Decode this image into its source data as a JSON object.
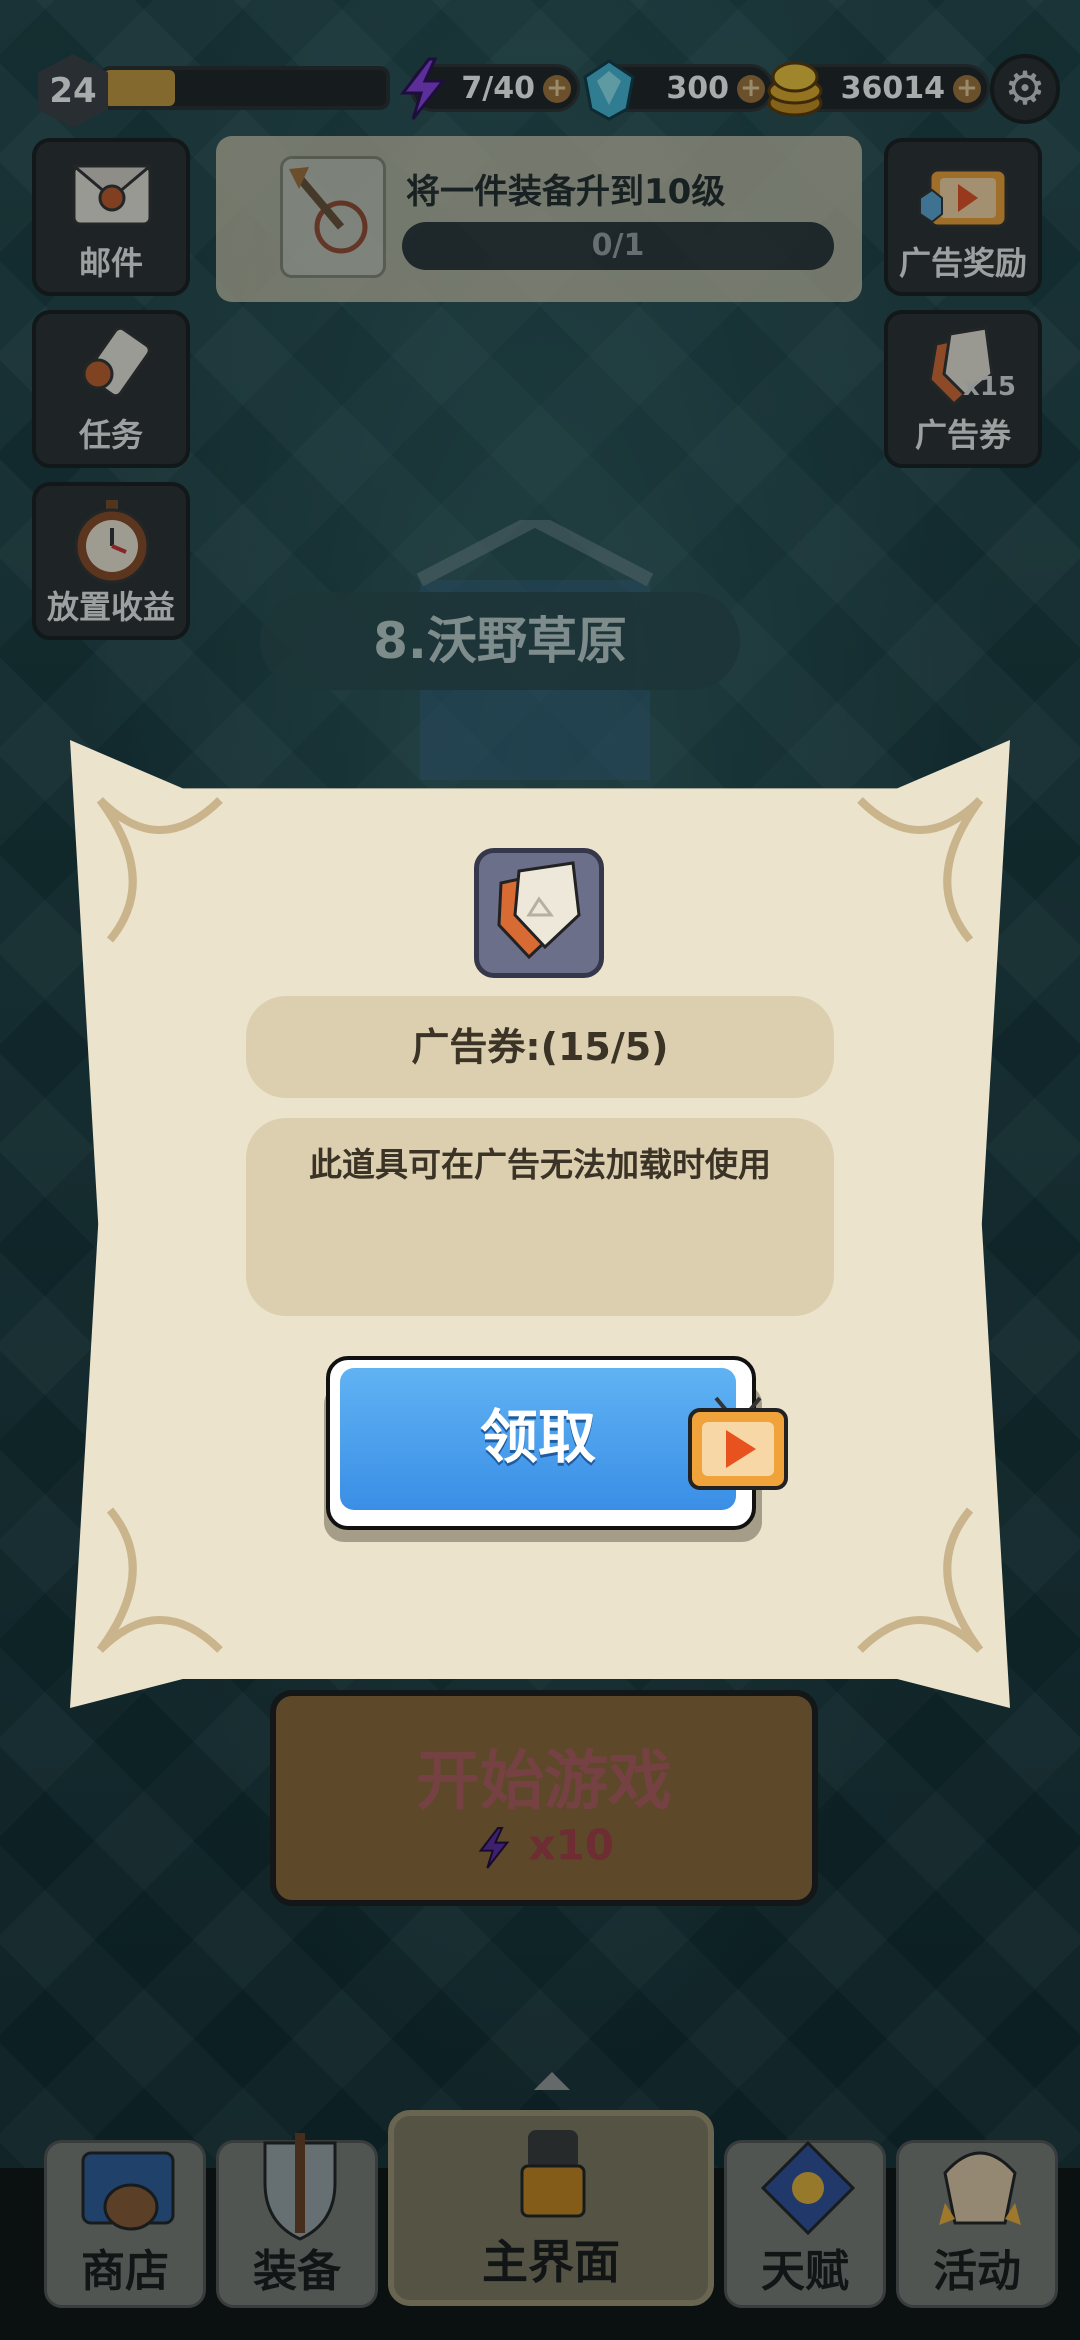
{
  "player": {
    "level": "24",
    "xp_fraction": 0.25
  },
  "resources": {
    "energy": "7/40",
    "gems": "300",
    "coins": "36014"
  },
  "side_left": [
    {
      "label": "邮件",
      "icon": "mail-icon"
    },
    {
      "label": "任务",
      "icon": "scroll-icon"
    },
    {
      "label": "放置收益",
      "icon": "stopwatch-icon"
    }
  ],
  "side_right": [
    {
      "label": "广告奖励",
      "icon": "tv-ad-icon"
    },
    {
      "label": "广告券",
      "count": "x15",
      "icon": "ad-ticket-icon"
    }
  ],
  "quest": {
    "title": "将一件装备升到10级",
    "progress": "0/1"
  },
  "stage": {
    "name": "8.沃野草原"
  },
  "dialog": {
    "count_text": "广告券:(15/5)",
    "description": "此道具可在广告无法加载时使用",
    "claim_label": "领取"
  },
  "start": {
    "label": "开始游戏",
    "cost": "x10"
  },
  "nav": [
    {
      "label": "商店",
      "icon": "shop-icon"
    },
    {
      "label": "装备",
      "icon": "sword-shield-icon"
    },
    {
      "label": "主界面",
      "icon": "armor-icon"
    },
    {
      "label": "天赋",
      "icon": "talent-icon"
    },
    {
      "label": "活动",
      "icon": "event-icon"
    }
  ],
  "colors": {
    "claim_blue": "#3a8ee6",
    "dialog_bg": "#ece3cc",
    "energy_purple": "#8a3fe0"
  }
}
